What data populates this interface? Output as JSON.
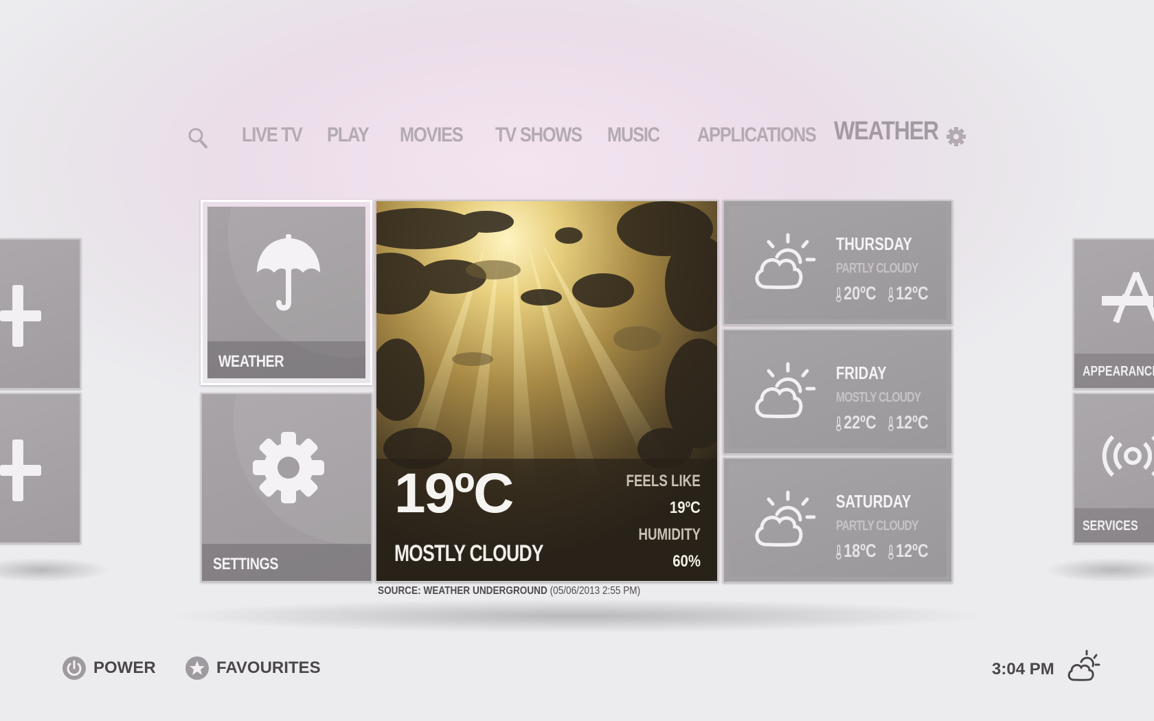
{
  "nav": {
    "items": [
      "LIVE TV",
      "PLAY",
      "MOVIES",
      "TV SHOWS",
      "MUSIC",
      "APPLICATIONS",
      "WEATHER"
    ],
    "active": "WEATHER",
    "search_icon": "search-icon",
    "settings_icon": "gear-icon"
  },
  "tiles": {
    "weather_label": "WEATHER",
    "settings_label": "SETTINGS"
  },
  "side_tiles": {
    "left_top_icon": "plus-icon",
    "left_bottom_icon": "plus-icon",
    "right_top_label": "APPEARANCE",
    "right_bottom_label": "SERVICES"
  },
  "current": {
    "temp": "19ºC",
    "condition": "MOSTLY CLOUDY",
    "feels_like_label": "FEELS LIKE",
    "feels_like": "19ºC",
    "humidity_label": "HUMIDITY",
    "humidity": "60%"
  },
  "forecast": [
    {
      "day": "THURSDAY",
      "condition": "PARTLY CLOUDY",
      "high": "20ºC",
      "low": "12ºC"
    },
    {
      "day": "FRIDAY",
      "condition": "MOSTLY CLOUDY",
      "high": "22ºC",
      "low": "12ºC"
    },
    {
      "day": "SATURDAY",
      "condition": "PARTLY CLOUDY",
      "high": "18ºC",
      "low": "12ºC"
    }
  ],
  "source": {
    "label": "SOURCE: WEATHER UNDERGROUND",
    "timestamp": "(05/06/2013 2:55 PM)"
  },
  "footer": {
    "power": "POWER",
    "favourites": "FAVOURITES",
    "clock": "3:04 PM"
  },
  "colors": {
    "nav_text": "#b3aab3",
    "tile_bg": "#a3a0a3",
    "footer_text": "#4a464a"
  }
}
